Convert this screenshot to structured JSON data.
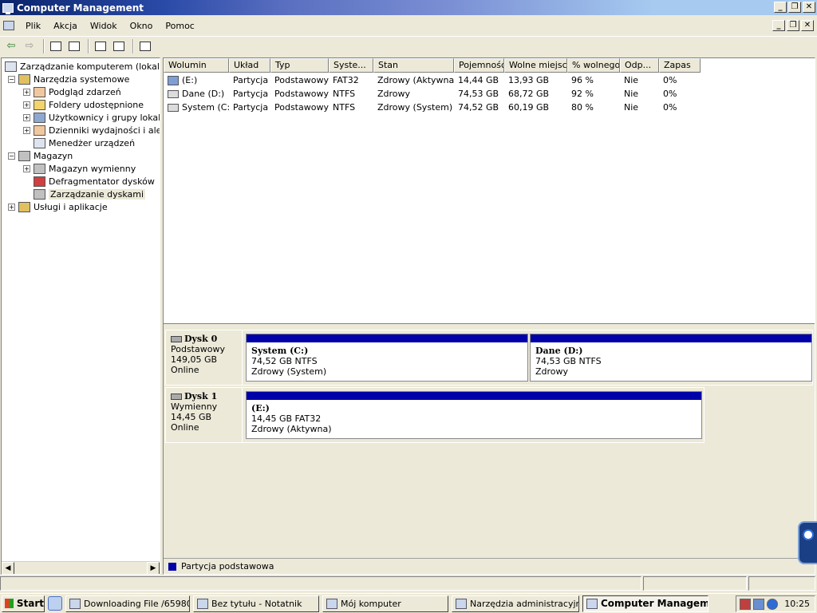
{
  "window": {
    "title": "Computer Management"
  },
  "menu": [
    "Plik",
    "Akcja",
    "Widok",
    "Okno",
    "Pomoc"
  ],
  "tree": {
    "root": "Zarządzanie komputerem (lokalne)",
    "system_tools": "Narzędzia systemowe",
    "event_viewer": "Podgląd zdarzeń",
    "shared_folders": "Foldery udostępnione",
    "local_users": "Użytkownicy i grupy lokalne",
    "perf_logs": "Dzienniki wydajności i alerty",
    "device_manager": "Menedżer urządzeń",
    "storage": "Magazyn",
    "removable_storage": "Magazyn wymienny",
    "defragmenter": "Defragmentator dysków",
    "disk_management": "Zarządzanie dyskami",
    "services_apps": "Usługi i aplikacje"
  },
  "volumes": {
    "headers": [
      "Wolumin",
      "Układ",
      "Typ",
      "Syste...",
      "Stan",
      "Pojemność",
      "Wolne miejsce",
      "% wolnego",
      "Odp...",
      "Zapas"
    ],
    "rows": [
      [
        "(E:)",
        "Partycja",
        "Podstawowy",
        "FAT32",
        "Zdrowy (Aktywna)",
        "14,44 GB",
        "13,93 GB",
        "96 %",
        "Nie",
        "0%"
      ],
      [
        "Dane (D:)",
        "Partycja",
        "Podstawowy",
        "NTFS",
        "Zdrowy",
        "74,53 GB",
        "68,72 GB",
        "92 %",
        "Nie",
        "0%"
      ],
      [
        "System (C:)",
        "Partycja",
        "Podstawowy",
        "NTFS",
        "Zdrowy (System)",
        "74,52 GB",
        "60,19 GB",
        "80 %",
        "Nie",
        "0%"
      ]
    ]
  },
  "disks": [
    {
      "name": "Dysk 0",
      "type": "Podstawowy",
      "size": "149,05 GB",
      "status": "Online",
      "partitions": [
        {
          "title": "System  (C:)",
          "size": "74,52 GB NTFS",
          "state": "Zdrowy (System)"
        },
        {
          "title": "Dane  (D:)",
          "size": "74,53 GB NTFS",
          "state": "Zdrowy"
        }
      ]
    },
    {
      "name": "Dysk 1",
      "type": "Wymienny",
      "size": "14,45 GB",
      "status": "Online",
      "partitions": [
        {
          "title": " (E:)",
          "size": "14,45 GB FAT32",
          "state": "Zdrowy (Aktywna)"
        }
      ]
    }
  ],
  "legend": {
    "primary": "Partycja podstawowa",
    "color": "#0000a8"
  },
  "taskbar": {
    "start": "Start",
    "items": [
      "Downloading File /65980...",
      "Bez tytułu - Notatnik",
      "Mój komputer",
      "Narzędzia administracyjne",
      "Computer Manageme..."
    ],
    "clock": "10:25"
  }
}
